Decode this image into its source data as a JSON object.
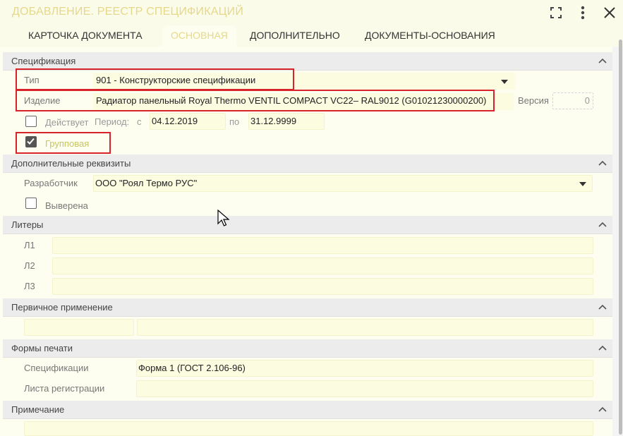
{
  "window": {
    "title": "ДОБАВЛЕНИЕ. РЕЕСТР СПЕЦИФИКАЦИЙ"
  },
  "tabs": [
    {
      "label": "КАРТОЧКА ДОКУМЕНТА",
      "active": false
    },
    {
      "label": "ОСНОВНАЯ",
      "active": true
    },
    {
      "label": "ДОПОЛНИТЕЛЬНО",
      "active": false
    },
    {
      "label": "ДОКУМЕНТЫ-ОСНОВАНИЯ",
      "active": false
    }
  ],
  "sections": {
    "spec": {
      "title": "Спецификация",
      "type_label": "Тип",
      "type_value": "901 - Конструкторские спецификации",
      "item_label": "Изделие",
      "item_value": "Радиатор панельный Royal Thermo VENTIL COMPACT VC22– RAL9012 (G01021230000200)",
      "version_label": "Версия",
      "version_value": "0",
      "active_label": "Действует",
      "active_checked": false,
      "period_label": "Период:",
      "from_label": "с",
      "from_value": "04.12.2019",
      "to_label": "по",
      "to_value": "31.12.9999",
      "group_label": "Групповая",
      "group_checked": true
    },
    "extra": {
      "title": "Дополнительные реквизиты",
      "developer_label": "Разработчик",
      "developer_value": "ООО \"Роял Термо РУС\"",
      "verified_label": "Выверена",
      "verified_checked": false
    },
    "liters": {
      "title": "Литеры",
      "l1_label": "Л1",
      "l2_label": "Л2",
      "l3_label": "Л3"
    },
    "primary": {
      "title": "Первичное применение"
    },
    "print": {
      "title": "Формы печати",
      "spec_label": "Спецификации",
      "spec_value": "Форма 1 (ГОСТ 2.106-96)",
      "reg_label": "Листа регистрации"
    },
    "note": {
      "title": "Примечание"
    }
  },
  "colors": {
    "accent": "#e6d88a",
    "highlight": "#d8232a",
    "field_bg": "#fcfce1",
    "section_bg": "#ececec"
  }
}
